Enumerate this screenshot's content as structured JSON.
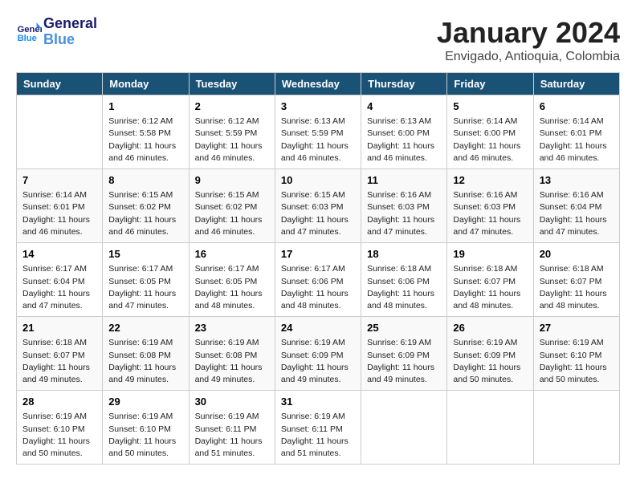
{
  "header": {
    "logo_line1": "General",
    "logo_line2": "Blue",
    "month_title": "January 2024",
    "location": "Envigado, Antioquia, Colombia"
  },
  "weekdays": [
    "Sunday",
    "Monday",
    "Tuesday",
    "Wednesday",
    "Thursday",
    "Friday",
    "Saturday"
  ],
  "weeks": [
    [
      {
        "num": "",
        "info": ""
      },
      {
        "num": "1",
        "info": "Sunrise: 6:12 AM\nSunset: 5:58 PM\nDaylight: 11 hours\nand 46 minutes."
      },
      {
        "num": "2",
        "info": "Sunrise: 6:12 AM\nSunset: 5:59 PM\nDaylight: 11 hours\nand 46 minutes."
      },
      {
        "num": "3",
        "info": "Sunrise: 6:13 AM\nSunset: 5:59 PM\nDaylight: 11 hours\nand 46 minutes."
      },
      {
        "num": "4",
        "info": "Sunrise: 6:13 AM\nSunset: 6:00 PM\nDaylight: 11 hours\nand 46 minutes."
      },
      {
        "num": "5",
        "info": "Sunrise: 6:14 AM\nSunset: 6:00 PM\nDaylight: 11 hours\nand 46 minutes."
      },
      {
        "num": "6",
        "info": "Sunrise: 6:14 AM\nSunset: 6:01 PM\nDaylight: 11 hours\nand 46 minutes."
      }
    ],
    [
      {
        "num": "7",
        "info": "Sunrise: 6:14 AM\nSunset: 6:01 PM\nDaylight: 11 hours\nand 46 minutes."
      },
      {
        "num": "8",
        "info": "Sunrise: 6:15 AM\nSunset: 6:02 PM\nDaylight: 11 hours\nand 46 minutes."
      },
      {
        "num": "9",
        "info": "Sunrise: 6:15 AM\nSunset: 6:02 PM\nDaylight: 11 hours\nand 46 minutes."
      },
      {
        "num": "10",
        "info": "Sunrise: 6:15 AM\nSunset: 6:03 PM\nDaylight: 11 hours\nand 47 minutes."
      },
      {
        "num": "11",
        "info": "Sunrise: 6:16 AM\nSunset: 6:03 PM\nDaylight: 11 hours\nand 47 minutes."
      },
      {
        "num": "12",
        "info": "Sunrise: 6:16 AM\nSunset: 6:03 PM\nDaylight: 11 hours\nand 47 minutes."
      },
      {
        "num": "13",
        "info": "Sunrise: 6:16 AM\nSunset: 6:04 PM\nDaylight: 11 hours\nand 47 minutes."
      }
    ],
    [
      {
        "num": "14",
        "info": "Sunrise: 6:17 AM\nSunset: 6:04 PM\nDaylight: 11 hours\nand 47 minutes."
      },
      {
        "num": "15",
        "info": "Sunrise: 6:17 AM\nSunset: 6:05 PM\nDaylight: 11 hours\nand 47 minutes."
      },
      {
        "num": "16",
        "info": "Sunrise: 6:17 AM\nSunset: 6:05 PM\nDaylight: 11 hours\nand 48 minutes."
      },
      {
        "num": "17",
        "info": "Sunrise: 6:17 AM\nSunset: 6:06 PM\nDaylight: 11 hours\nand 48 minutes."
      },
      {
        "num": "18",
        "info": "Sunrise: 6:18 AM\nSunset: 6:06 PM\nDaylight: 11 hours\nand 48 minutes."
      },
      {
        "num": "19",
        "info": "Sunrise: 6:18 AM\nSunset: 6:07 PM\nDaylight: 11 hours\nand 48 minutes."
      },
      {
        "num": "20",
        "info": "Sunrise: 6:18 AM\nSunset: 6:07 PM\nDaylight: 11 hours\nand 48 minutes."
      }
    ],
    [
      {
        "num": "21",
        "info": "Sunrise: 6:18 AM\nSunset: 6:07 PM\nDaylight: 11 hours\nand 49 minutes."
      },
      {
        "num": "22",
        "info": "Sunrise: 6:19 AM\nSunset: 6:08 PM\nDaylight: 11 hours\nand 49 minutes."
      },
      {
        "num": "23",
        "info": "Sunrise: 6:19 AM\nSunset: 6:08 PM\nDaylight: 11 hours\nand 49 minutes."
      },
      {
        "num": "24",
        "info": "Sunrise: 6:19 AM\nSunset: 6:09 PM\nDaylight: 11 hours\nand 49 minutes."
      },
      {
        "num": "25",
        "info": "Sunrise: 6:19 AM\nSunset: 6:09 PM\nDaylight: 11 hours\nand 49 minutes."
      },
      {
        "num": "26",
        "info": "Sunrise: 6:19 AM\nSunset: 6:09 PM\nDaylight: 11 hours\nand 50 minutes."
      },
      {
        "num": "27",
        "info": "Sunrise: 6:19 AM\nSunset: 6:10 PM\nDaylight: 11 hours\nand 50 minutes."
      }
    ],
    [
      {
        "num": "28",
        "info": "Sunrise: 6:19 AM\nSunset: 6:10 PM\nDaylight: 11 hours\nand 50 minutes."
      },
      {
        "num": "29",
        "info": "Sunrise: 6:19 AM\nSunset: 6:10 PM\nDaylight: 11 hours\nand 50 minutes."
      },
      {
        "num": "30",
        "info": "Sunrise: 6:19 AM\nSunset: 6:11 PM\nDaylight: 11 hours\nand 51 minutes."
      },
      {
        "num": "31",
        "info": "Sunrise: 6:19 AM\nSunset: 6:11 PM\nDaylight: 11 hours\nand 51 minutes."
      },
      {
        "num": "",
        "info": ""
      },
      {
        "num": "",
        "info": ""
      },
      {
        "num": "",
        "info": ""
      }
    ]
  ]
}
